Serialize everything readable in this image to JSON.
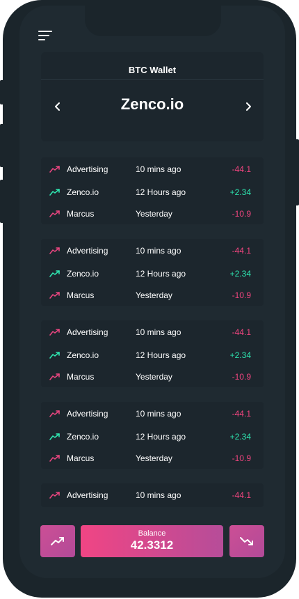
{
  "header": {
    "title": "BTC Wallet"
  },
  "wallet": {
    "name": "Zenco.io"
  },
  "groups": [
    {
      "rows": [
        {
          "name": "Advertising",
          "time": "10 mins ago",
          "amount": "-44.1",
          "direction": "down"
        },
        {
          "name": "Zenco.io",
          "time": "12 Hours ago",
          "amount": "+2.34",
          "direction": "up"
        },
        {
          "name": "Marcus",
          "time": "Yesterday",
          "amount": "-10.9",
          "direction": "down"
        }
      ]
    },
    {
      "rows": [
        {
          "name": "Advertising",
          "time": "10 mins ago",
          "amount": "-44.1",
          "direction": "down"
        },
        {
          "name": "Zenco.io",
          "time": "12 Hours ago",
          "amount": "+2.34",
          "direction": "up"
        },
        {
          "name": "Marcus",
          "time": "Yesterday",
          "amount": "-10.9",
          "direction": "down"
        }
      ]
    },
    {
      "rows": [
        {
          "name": "Advertising",
          "time": "10 mins ago",
          "amount": "-44.1",
          "direction": "down"
        },
        {
          "name": "Zenco.io",
          "time": "12 Hours ago",
          "amount": "+2.34",
          "direction": "up"
        },
        {
          "name": "Marcus",
          "time": "Yesterday",
          "amount": "-10.9",
          "direction": "down"
        }
      ]
    },
    {
      "rows": [
        {
          "name": "Advertising",
          "time": "10 mins ago",
          "amount": "-44.1",
          "direction": "down"
        },
        {
          "name": "Zenco.io",
          "time": "12 Hours ago",
          "amount": "+2.34",
          "direction": "up"
        },
        {
          "name": "Marcus",
          "time": "Yesterday",
          "amount": "-10.9",
          "direction": "down"
        }
      ]
    },
    {
      "rows": [
        {
          "name": "Advertising",
          "time": "10 mins ago",
          "amount": "-44.1",
          "direction": "down"
        }
      ]
    }
  ],
  "balance": {
    "label": "Balance",
    "value": "42.3312"
  },
  "icons": {
    "menu": "menu-icon",
    "prev": "chevron-left-icon",
    "next": "chevron-right-icon",
    "trend_up": "trending-up-icon",
    "trend_down": "trending-down-icon"
  },
  "colors": {
    "positive": "#2ee6b0",
    "negative": "#f0457f",
    "trend_icon_down": "#e8457f",
    "trend_icon_up": "#2ee6b0"
  }
}
